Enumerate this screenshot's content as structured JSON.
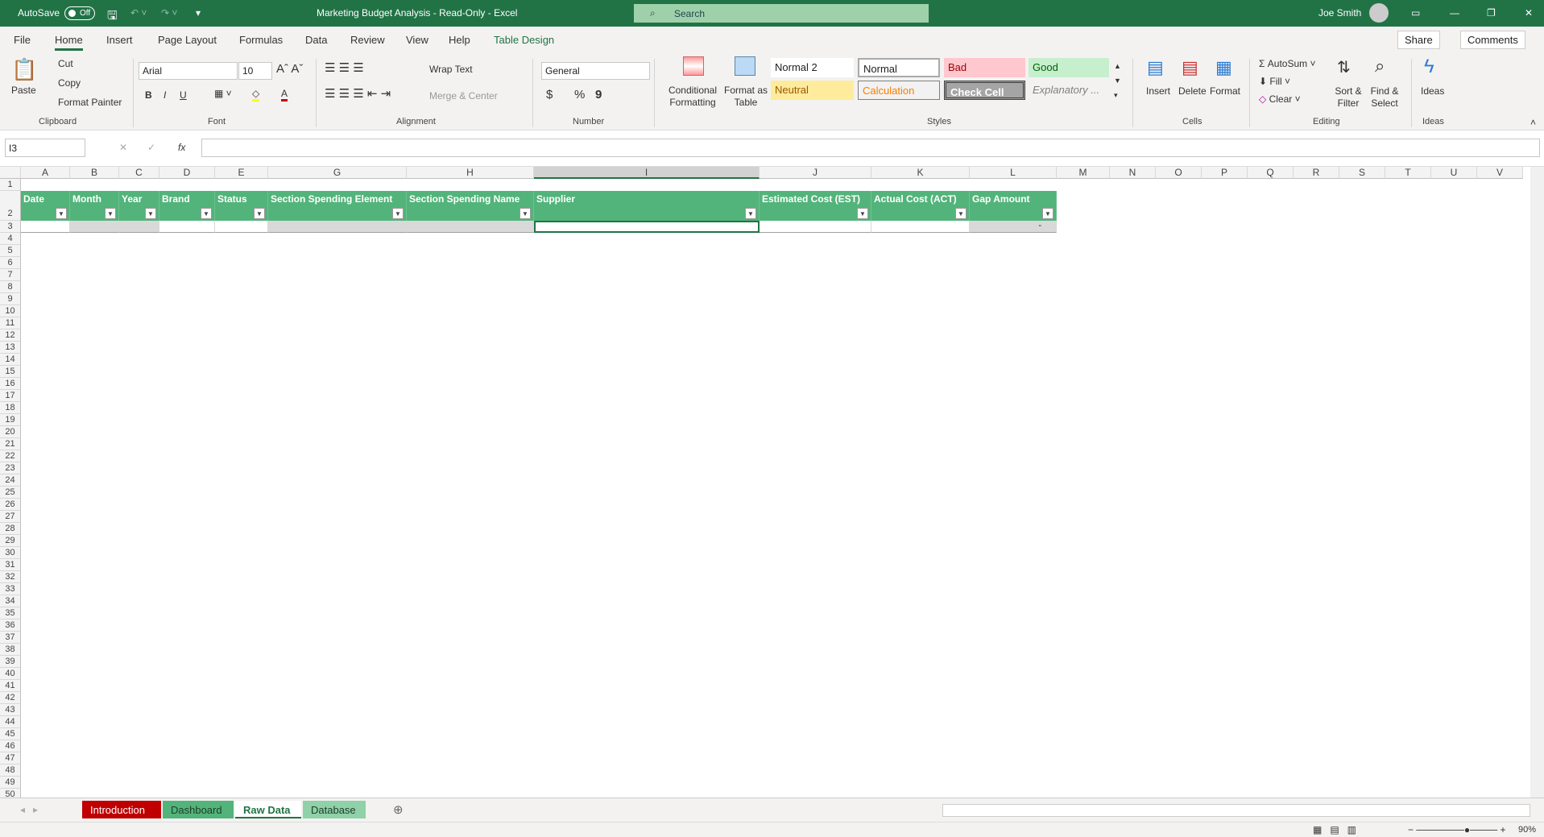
{
  "titlebar": {
    "autosave": "AutoSave",
    "autosave_state": "Off",
    "title": "Marketing Budget Analysis  -  Read-Only  -  Excel",
    "search": "Search",
    "user": "Joe Smith"
  },
  "tabs": [
    "File",
    "Home",
    "Insert",
    "Page Layout",
    "Formulas",
    "Data",
    "Review",
    "View",
    "Help",
    "Table Design"
  ],
  "share": "Share",
  "comments": "Comments",
  "ribbon": {
    "clipboard": {
      "paste": "Paste",
      "cut": "Cut",
      "copy": "Copy",
      "format_painter": "Format Painter",
      "label": "Clipboard"
    },
    "font": {
      "name": "Arial",
      "size": "10",
      "bold": "B",
      "italic": "I",
      "underline": "U",
      "label": "Font"
    },
    "alignment": {
      "wrap": "Wrap Text",
      "merge": "Merge & Center",
      "label": "Alignment"
    },
    "number": {
      "format": "General",
      "currency": "$",
      "percent": "%",
      "comma": "9",
      "label": "Number"
    },
    "styles": {
      "cond": "Conditional Formatting",
      "fmt_table": "Format as Table",
      "items": [
        "Normal 2",
        "Normal",
        "Bad",
        "Good",
        "Neutral",
        "Calculation",
        "Check Cell",
        "Explanatory ..."
      ],
      "label": "Styles"
    },
    "cells": {
      "insert": "Insert",
      "delete": "Delete",
      "format": "Format",
      "label": "Cells"
    },
    "editing": {
      "autosum": "AutoSum",
      "fill": "Fill",
      "clear": "Clear",
      "sort": "Sort & Filter",
      "find": "Find & Select",
      "label": "Editing"
    },
    "ideas": {
      "ideas": "Ideas",
      "label": "Ideas"
    }
  },
  "formula_bar": {
    "name_box": "I3",
    "fx": "fx",
    "value": ""
  },
  "columns": [
    "A",
    "B",
    "C",
    "D",
    "E",
    "G",
    "H",
    "I",
    "J",
    "K",
    "L",
    "M",
    "N",
    "O",
    "P",
    "Q",
    "R",
    "S",
    "T",
    "U",
    "V"
  ],
  "selected_column": "I",
  "table_headers": [
    "Date",
    "Month",
    "Year",
    "Brand",
    "Status",
    "Section Spending Element",
    "Section Spending Name",
    "Supplier",
    "Estimated Cost (EST)",
    "Actual Cost (ACT)",
    "Gap Amount"
  ],
  "row3_gap": "-",
  "row_count": 50,
  "sheets": [
    "Introduction",
    "Dashboard",
    "Raw Data",
    "Database"
  ],
  "active_sheet": "Raw Data",
  "sheet_colors": {
    "Introduction": "#c00000",
    "Dashboard": "#52b47a",
    "Raw Data": "#ffffff",
    "Database": "#8fd1a8"
  },
  "zoom": "90%"
}
